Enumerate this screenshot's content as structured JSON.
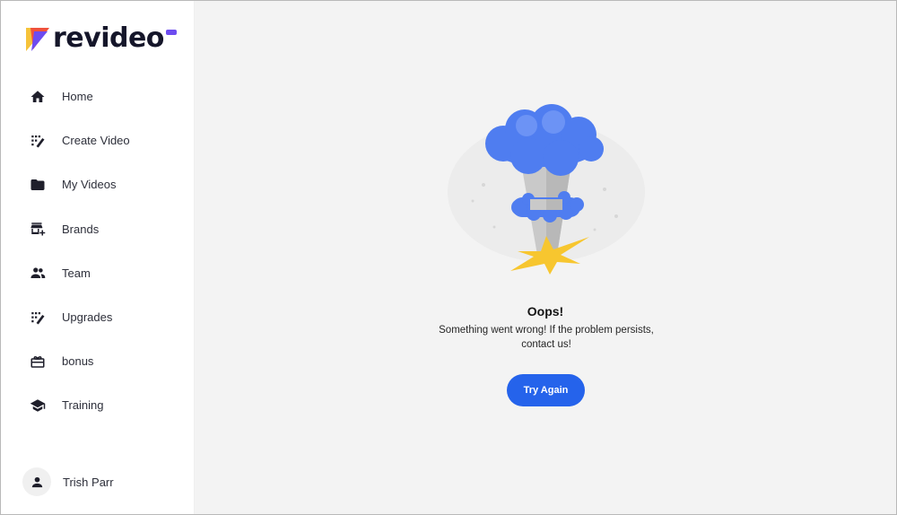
{
  "brand": {
    "name": "revideo",
    "colors": {
      "yellow": "#f6c33a",
      "orange": "#f0523b",
      "purple": "#6d4cf0",
      "dark": "#15162a"
    }
  },
  "sidebar": {
    "items": [
      {
        "label": "Home",
        "icon": "home-icon"
      },
      {
        "label": "Create Video",
        "icon": "magic-wand-icon"
      },
      {
        "label": "My Videos",
        "icon": "folder-icon"
      },
      {
        "label": "Brands",
        "icon": "store-add-icon"
      },
      {
        "label": "Team",
        "icon": "people-icon"
      },
      {
        "label": "Upgrades",
        "icon": "magic-wand-icon"
      },
      {
        "label": "bonus",
        "icon": "gift-icon"
      },
      {
        "label": "Training",
        "icon": "graduation-cap-icon"
      }
    ],
    "user": {
      "name": "Trish Parr",
      "icon": "person-icon"
    }
  },
  "error": {
    "title": "Oops!",
    "message": "Something went wrong! If the problem persists, contact us!",
    "button_label": "Try Again",
    "illustration_icon": "explosion-cloud-illustration",
    "colors": {
      "button": "#2563eb",
      "cloud": "#4f7df0",
      "flash": "#f7c62f"
    }
  }
}
